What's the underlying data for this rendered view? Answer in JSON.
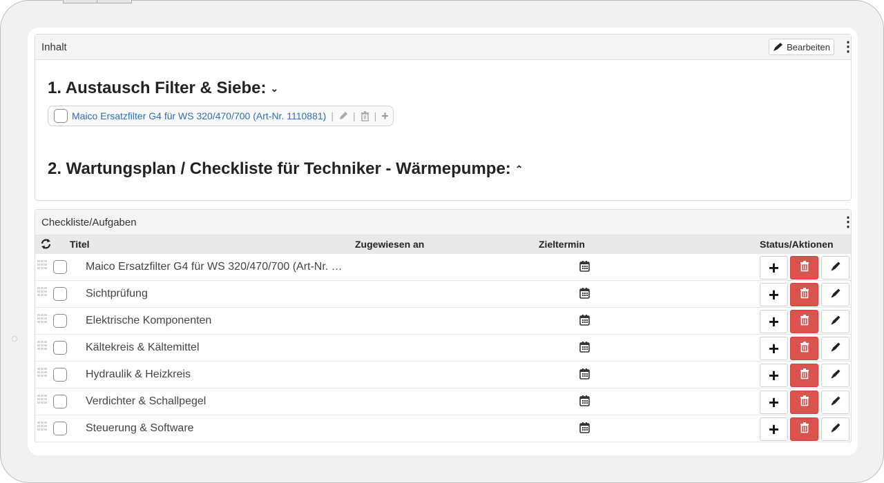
{
  "content_panel": {
    "title": "Inhalt",
    "edit_label": "Bearbeiten",
    "section1": {
      "heading": "1. Austausch Filter & Siebe:",
      "caret": "⌄"
    },
    "article_link": "Maico Ersatzfilter G4 für WS 320/470/700 (Art-Nr. 1110881)",
    "section2": {
      "heading": "2. Wartungsplan / Checkliste für Techniker - Wärmepumpe:",
      "caret": "⌃"
    }
  },
  "checklist_panel": {
    "title": "Checkliste/Aufgaben",
    "columns": {
      "title": "Titel",
      "assigned": "Zugewiesen an",
      "due": "Zieltermin",
      "status": "Status/Aktionen"
    },
    "rows": [
      {
        "title": "Maico Ersatzfilter G4 für WS 320/470/700 (Art-Nr. …"
      },
      {
        "title": "Sichtprüfung"
      },
      {
        "title": "Elektrische Komponenten"
      },
      {
        "title": "Kältekreis & Kältemittel"
      },
      {
        "title": "Hydraulik & Heizkreis"
      },
      {
        "title": "Verdichter & Schallpegel"
      },
      {
        "title": "Steuerung & Software"
      }
    ]
  },
  "icons": {
    "edit": "pencil-icon",
    "menu": "kebab-menu-icon",
    "refresh": "refresh-icon",
    "calendar": "calendar-icon",
    "add": "plus-icon",
    "delete": "trash-icon",
    "drag": "drag-handle-icon"
  },
  "colors": {
    "link": "#2a6fb8",
    "danger": "#d9534f"
  }
}
